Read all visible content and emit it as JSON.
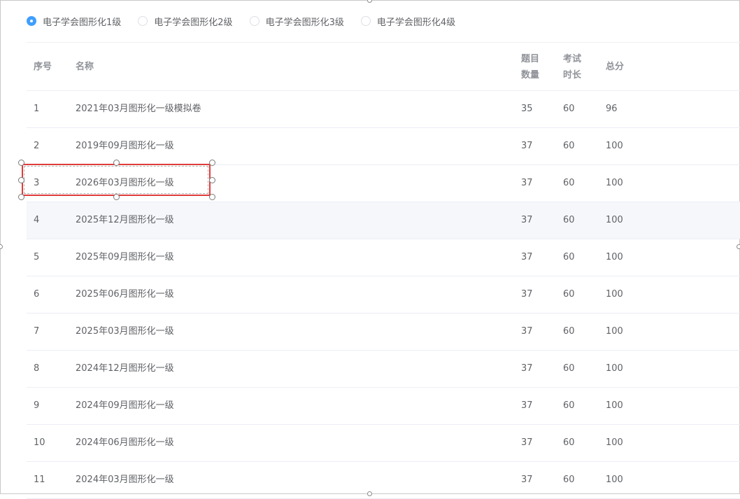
{
  "radio_group": {
    "options": [
      {
        "label": "电子学会图形化1级",
        "checked": true
      },
      {
        "label": "电子学会图形化2级",
        "checked": false
      },
      {
        "label": "电子学会图形化3级",
        "checked": false
      },
      {
        "label": "电子学会图形化4级",
        "checked": false
      }
    ]
  },
  "table": {
    "headers": {
      "index": "序号",
      "name": "名称",
      "count_line1": "题目",
      "count_line2": "数量",
      "time_line1": "考试",
      "time_line2": "时长",
      "score": "总分"
    },
    "rows": [
      {
        "index": "1",
        "name": "2021年03月图形化一级模拟卷",
        "count": "35",
        "time": "60",
        "score": "96"
      },
      {
        "index": "2",
        "name": "2019年09月图形化一级",
        "count": "37",
        "time": "60",
        "score": "100"
      },
      {
        "index": "3",
        "name": "2026年03月图形化一级",
        "count": "37",
        "time": "60",
        "score": "100"
      },
      {
        "index": "4",
        "name": "2025年12月图形化一级",
        "count": "37",
        "time": "60",
        "score": "100"
      },
      {
        "index": "5",
        "name": "2025年09月图形化一级",
        "count": "37",
        "time": "60",
        "score": "100"
      },
      {
        "index": "6",
        "name": "2025年06月图形化一级",
        "count": "37",
        "time": "60",
        "score": "100"
      },
      {
        "index": "7",
        "name": "2025年03月图形化一级",
        "count": "37",
        "time": "60",
        "score": "100"
      },
      {
        "index": "8",
        "name": "2024年12月图形化一级",
        "count": "37",
        "time": "60",
        "score": "100"
      },
      {
        "index": "9",
        "name": "2024年09月图形化一级",
        "count": "37",
        "time": "60",
        "score": "100"
      },
      {
        "index": "10",
        "name": "2024年06月图形化一级",
        "count": "37",
        "time": "60",
        "score": "100"
      },
      {
        "index": "11",
        "name": "2024年03月图形化一级",
        "count": "37",
        "time": "60",
        "score": "100"
      }
    ],
    "hovered_row": 4
  },
  "colors": {
    "accent": "#409eff",
    "selection_border": "#e03c3c",
    "hover_row": "#f5f7fa"
  }
}
